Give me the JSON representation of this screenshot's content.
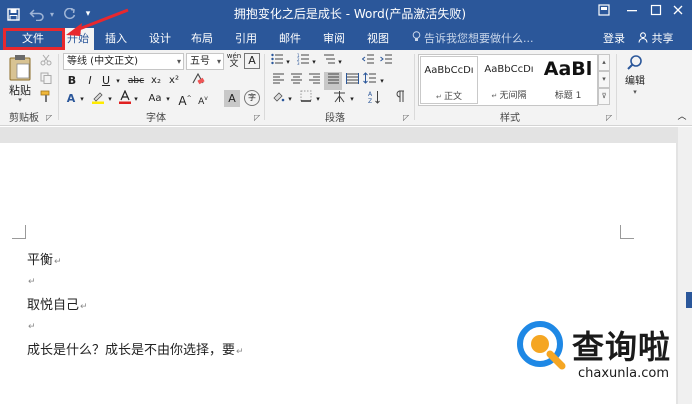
{
  "window": {
    "title": "拥抱变化之后是成长 - Word(产品激活失败)",
    "controls": [
      "restore-icon",
      "minimize-icon",
      "maximize-icon",
      "close-icon"
    ]
  },
  "qat": {
    "save": "save-icon",
    "undo": "undo-icon",
    "redo": "redo-icon",
    "customize": "▾"
  },
  "tabs": [
    {
      "label": "文件"
    },
    {
      "label": "开始"
    },
    {
      "label": "插入"
    },
    {
      "label": "设计"
    },
    {
      "label": "布局"
    },
    {
      "label": "引用"
    },
    {
      "label": "邮件"
    },
    {
      "label": "审阅"
    },
    {
      "label": "视图"
    }
  ],
  "active_tab": "开始",
  "tell_me": {
    "placeholder": "告诉我您想要做什么..."
  },
  "account": {
    "signin": "登录",
    "share": "共享"
  },
  "ribbon": {
    "clipboard": {
      "label": "剪贴板",
      "paste": "粘贴"
    },
    "font": {
      "label": "字体",
      "font_name": "等线 (中文正文)",
      "font_size": "五号",
      "phonetic": "wén",
      "bold": "B",
      "italic": "I",
      "underline": "U",
      "strike": "abc",
      "subscript": "x₂",
      "superscript": "x²",
      "change_case": "Aa",
      "grow": "A",
      "shrink": "A",
      "char_shading": "A",
      "enclose": "字"
    },
    "paragraph": {
      "label": "段落"
    },
    "styles": {
      "label": "样式",
      "items": [
        {
          "sample": "AaBbCcDı",
          "name": "正文"
        },
        {
          "sample": "AaBbCcDı",
          "name": "无间隔"
        },
        {
          "sample": "AaBl",
          "name": "标题 1"
        }
      ]
    },
    "editing": {
      "label": "编辑"
    }
  },
  "document": {
    "paragraphs": [
      "平衡",
      "",
      "取悦自己",
      "",
      "成长是什么？成长是不由你选择，要"
    ],
    "paragraph_mark": "↵"
  },
  "watermark": {
    "name": "查询啦",
    "url": "chaxunla.com"
  },
  "colors": {
    "word_blue": "#2b579a",
    "ribbon_bg": "#f3f3f3",
    "annotation_red": "#e8282e"
  }
}
